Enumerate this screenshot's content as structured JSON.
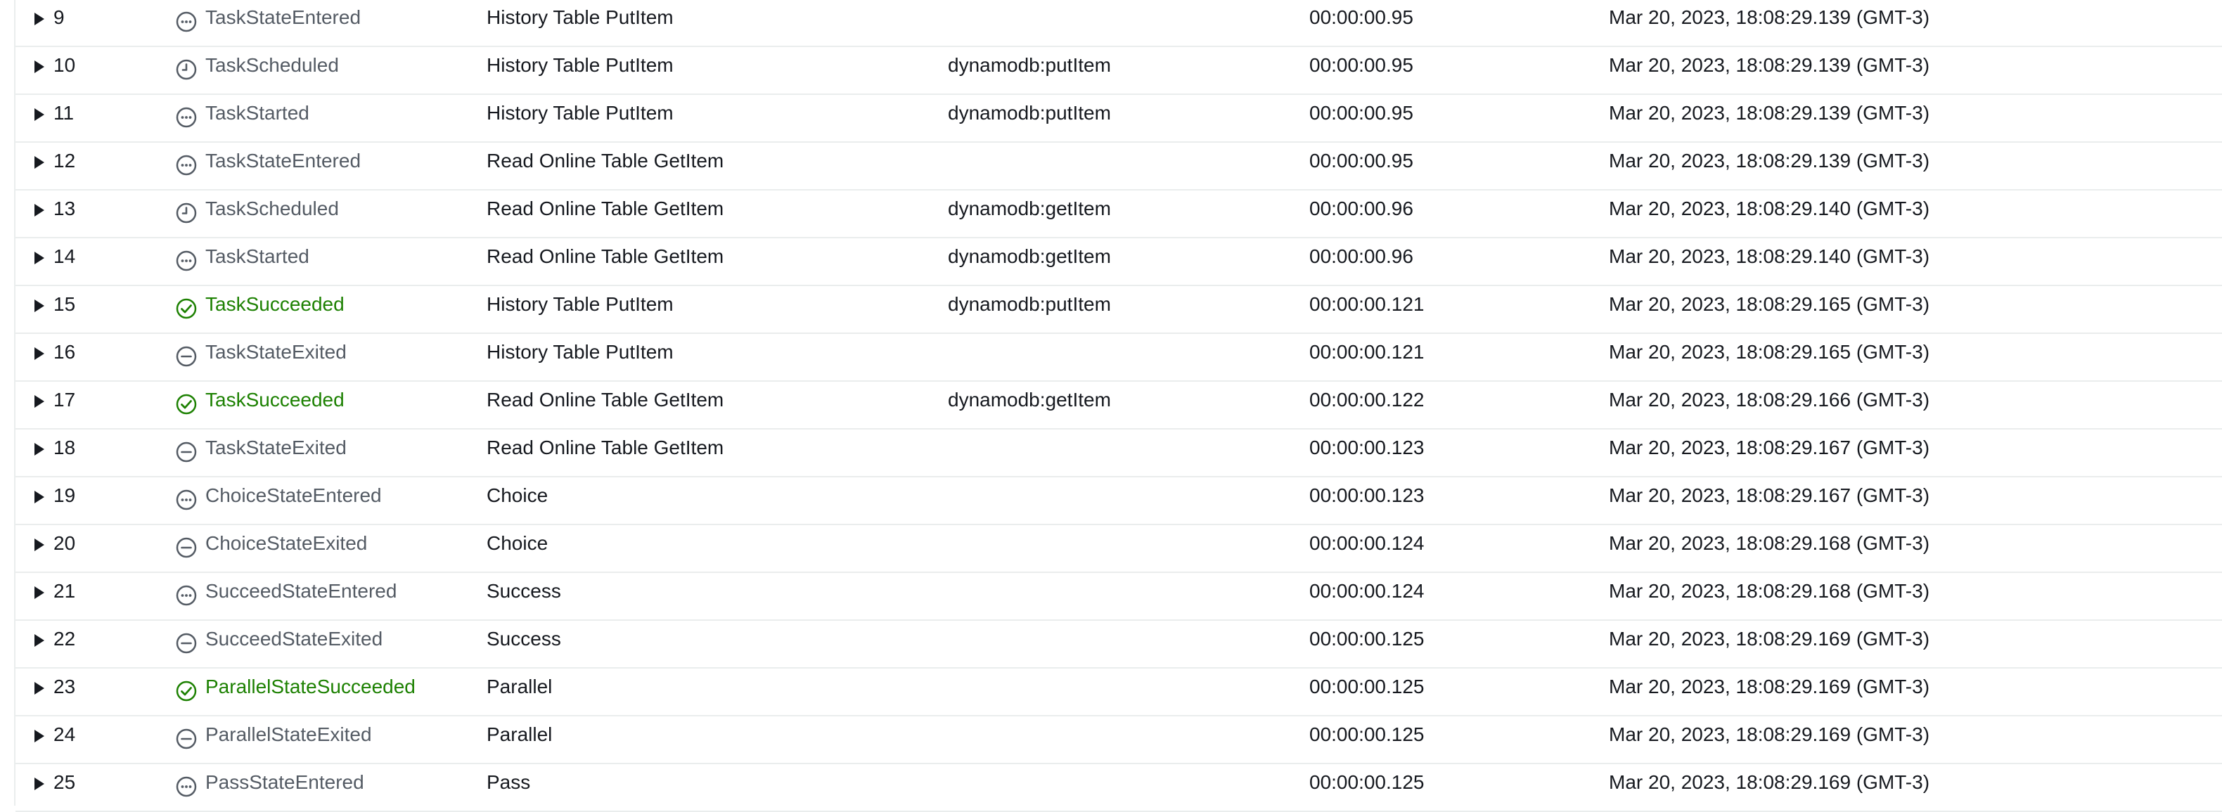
{
  "table": {
    "rows": [
      {
        "id": "9",
        "type": "TaskStateEntered",
        "icon": "dots-circle-icon",
        "status": "neutral",
        "step": "History Table PutItem",
        "resource": "",
        "elapsed": "00:00:00.95",
        "timestamp": "Mar 20, 2023, 18:08:29.139 (GMT-3)"
      },
      {
        "id": "10",
        "type": "TaskScheduled",
        "icon": "clock-icon",
        "status": "neutral",
        "step": "History Table PutItem",
        "resource": "dynamodb:putItem",
        "elapsed": "00:00:00.95",
        "timestamp": "Mar 20, 2023, 18:08:29.139 (GMT-3)"
      },
      {
        "id": "11",
        "type": "TaskStarted",
        "icon": "dots-circle-icon",
        "status": "neutral",
        "step": "History Table PutItem",
        "resource": "dynamodb:putItem",
        "elapsed": "00:00:00.95",
        "timestamp": "Mar 20, 2023, 18:08:29.139 (GMT-3)"
      },
      {
        "id": "12",
        "type": "TaskStateEntered",
        "icon": "dots-circle-icon",
        "status": "neutral",
        "step": "Read Online Table GetItem",
        "resource": "",
        "elapsed": "00:00:00.95",
        "timestamp": "Mar 20, 2023, 18:08:29.139 (GMT-3)"
      },
      {
        "id": "13",
        "type": "TaskScheduled",
        "icon": "clock-icon",
        "status": "neutral",
        "step": "Read Online Table GetItem",
        "resource": "dynamodb:getItem",
        "elapsed": "00:00:00.96",
        "timestamp": "Mar 20, 2023, 18:08:29.140 (GMT-3)"
      },
      {
        "id": "14",
        "type": "TaskStarted",
        "icon": "dots-circle-icon",
        "status": "neutral",
        "step": "Read Online Table GetItem",
        "resource": "dynamodb:getItem",
        "elapsed": "00:00:00.96",
        "timestamp": "Mar 20, 2023, 18:08:29.140 (GMT-3)"
      },
      {
        "id": "15",
        "type": "TaskSucceeded",
        "icon": "check-circle-icon",
        "status": "success",
        "step": "History Table PutItem",
        "resource": "dynamodb:putItem",
        "elapsed": "00:00:00.121",
        "timestamp": "Mar 20, 2023, 18:08:29.165 (GMT-3)"
      },
      {
        "id": "16",
        "type": "TaskStateExited",
        "icon": "minus-circle-icon",
        "status": "neutral",
        "step": "History Table PutItem",
        "resource": "",
        "elapsed": "00:00:00.121",
        "timestamp": "Mar 20, 2023, 18:08:29.165 (GMT-3)"
      },
      {
        "id": "17",
        "type": "TaskSucceeded",
        "icon": "check-circle-icon",
        "status": "success",
        "step": "Read Online Table GetItem",
        "resource": "dynamodb:getItem",
        "elapsed": "00:00:00.122",
        "timestamp": "Mar 20, 2023, 18:08:29.166 (GMT-3)"
      },
      {
        "id": "18",
        "type": "TaskStateExited",
        "icon": "minus-circle-icon",
        "status": "neutral",
        "step": "Read Online Table GetItem",
        "resource": "",
        "elapsed": "00:00:00.123",
        "timestamp": "Mar 20, 2023, 18:08:29.167 (GMT-3)"
      },
      {
        "id": "19",
        "type": "ChoiceStateEntered",
        "icon": "dots-circle-icon",
        "status": "neutral",
        "step": "Choice",
        "resource": "",
        "elapsed": "00:00:00.123",
        "timestamp": "Mar 20, 2023, 18:08:29.167 (GMT-3)"
      },
      {
        "id": "20",
        "type": "ChoiceStateExited",
        "icon": "minus-circle-icon",
        "status": "neutral",
        "step": "Choice",
        "resource": "",
        "elapsed": "00:00:00.124",
        "timestamp": "Mar 20, 2023, 18:08:29.168 (GMT-3)"
      },
      {
        "id": "21",
        "type": "SucceedStateEntered",
        "icon": "dots-circle-icon",
        "status": "neutral",
        "step": "Success",
        "resource": "",
        "elapsed": "00:00:00.124",
        "timestamp": "Mar 20, 2023, 18:08:29.168 (GMT-3)"
      },
      {
        "id": "22",
        "type": "SucceedStateExited",
        "icon": "minus-circle-icon",
        "status": "neutral",
        "step": "Success",
        "resource": "",
        "elapsed": "00:00:00.125",
        "timestamp": "Mar 20, 2023, 18:08:29.169 (GMT-3)"
      },
      {
        "id": "23",
        "type": "ParallelStateSucceeded",
        "icon": "check-circle-icon",
        "status": "success",
        "step": "Parallel",
        "resource": "",
        "elapsed": "00:00:00.125",
        "timestamp": "Mar 20, 2023, 18:08:29.169 (GMT-3)"
      },
      {
        "id": "24",
        "type": "ParallelStateExited",
        "icon": "minus-circle-icon",
        "status": "neutral",
        "step": "Parallel",
        "resource": "",
        "elapsed": "00:00:00.125",
        "timestamp": "Mar 20, 2023, 18:08:29.169 (GMT-3)"
      },
      {
        "id": "25",
        "type": "PassStateEntered",
        "icon": "dots-circle-icon",
        "status": "neutral",
        "step": "Pass",
        "resource": "",
        "elapsed": "00:00:00.125",
        "timestamp": "Mar 20, 2023, 18:08:29.169 (GMT-3)"
      }
    ]
  },
  "colors": {
    "neutral_icon": "#545b64",
    "success": "#1d8102",
    "row_border": "#eaeded",
    "text": "#16191f"
  }
}
